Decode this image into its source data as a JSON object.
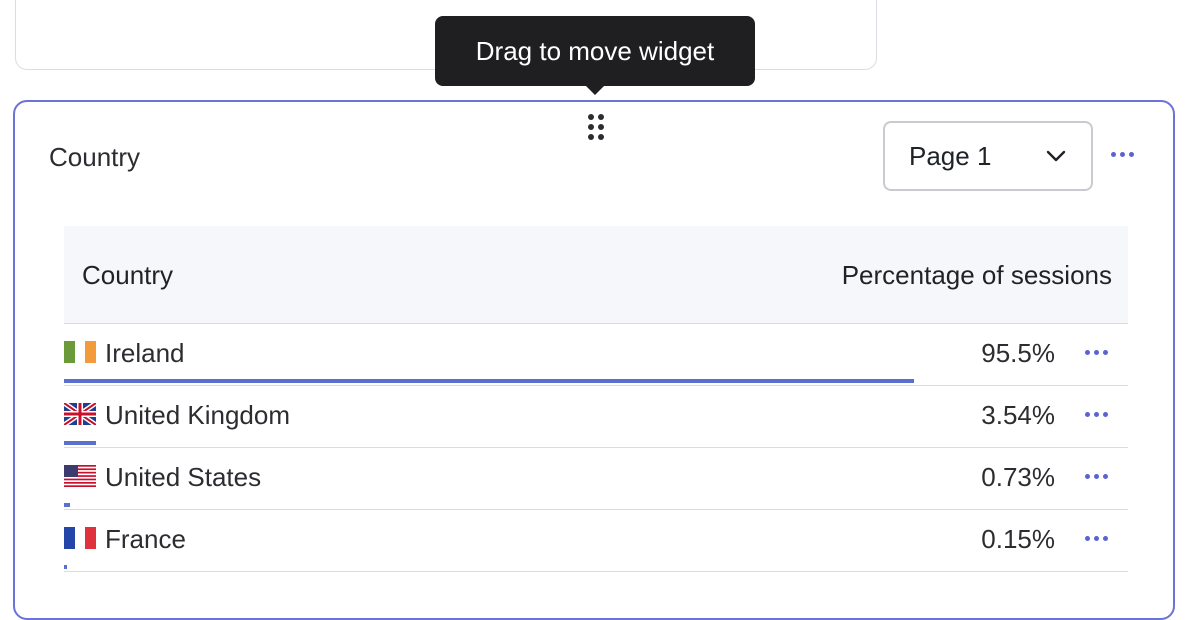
{
  "tooltip": {
    "text": "Drag to move widget"
  },
  "widget": {
    "title": "Country",
    "page_select": {
      "value": "Page 1"
    },
    "table": {
      "columns": [
        "Country",
        "Percentage of sessions"
      ],
      "rows": [
        {
          "country": "Ireland",
          "flag": "flag-ireland-icon",
          "percentage": "95.5%",
          "share": 0.955
        },
        {
          "country": "United Kingdom",
          "flag": "flag-uk-icon",
          "percentage": "3.54%",
          "share": 0.0354
        },
        {
          "country": "United States",
          "flag": "flag-us-icon",
          "percentage": "0.73%",
          "share": 0.0073
        },
        {
          "country": "France",
          "flag": "flag-france-icon",
          "percentage": "0.15%",
          "share": 0.0015
        }
      ]
    }
  },
  "colors": {
    "accent": "#5b63d3",
    "bar": "#5b6fd0",
    "border_active": "#6b73d6"
  }
}
